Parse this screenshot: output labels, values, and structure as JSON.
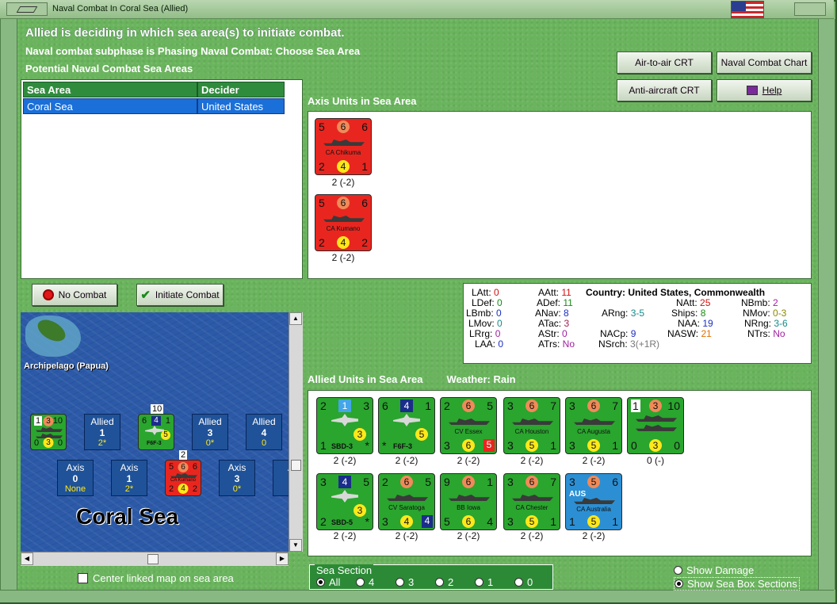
{
  "window": {
    "title": "Naval Combat In Coral Sea (Allied)"
  },
  "header": {
    "line1": "Allied is deciding in which sea area(s) to initiate combat.",
    "line2": "Naval combat subphase is Phasing Naval Combat: Choose Sea Area",
    "line3": "Potential Naval Combat Sea Areas"
  },
  "buttons": {
    "air_to_air": "Air-to-air CRT",
    "naval_chart": "Naval Combat Chart",
    "anti_aircraft": "Anti-aircraft CRT",
    "help": "Help",
    "no_combat": "No Combat",
    "initiate_combat": "Initiate Combat"
  },
  "sea_table": {
    "columns": [
      "Sea Area",
      "Decider"
    ],
    "rows": [
      [
        "Coral Sea",
        "United States"
      ]
    ]
  },
  "axis_units": {
    "label": "Axis Units in Sea Area",
    "units": [
      {
        "name": "CA Chikuma",
        "tl": "5",
        "tc": "6",
        "tr": "6",
        "bl": "2",
        "bc": "4",
        "br": "1",
        "strength": "2 (-2)"
      },
      {
        "name": "CA Kumano",
        "tl": "5",
        "tc": "6",
        "tr": "6",
        "bl": "2",
        "bc": "4",
        "br": "2",
        "strength": "2 (-2)"
      }
    ]
  },
  "stats": {
    "country_label": "Country:",
    "country": "United States, Commonwealth",
    "col1": [
      [
        "LAtt:",
        "0"
      ],
      [
        "LDef:",
        "0"
      ],
      [
        "LBmb:",
        "0"
      ],
      [
        "LMov:",
        "0"
      ],
      [
        "LRrg:",
        "0"
      ],
      [
        "LAA:",
        "0"
      ]
    ],
    "col2": [
      [
        "AAtt:",
        "11"
      ],
      [
        "ADef:",
        "11"
      ],
      [
        "ANav:",
        "8"
      ],
      [
        "ATac:",
        "3"
      ],
      [
        "AStr:",
        "0"
      ],
      [
        "ATrs:",
        "No"
      ]
    ],
    "col3": [
      [
        "ARng:",
        "3-5"
      ],
      [
        "NACp:",
        "9"
      ],
      [
        "NSrch:",
        "3(+1R)"
      ]
    ],
    "col4": [
      [
        "NAtt:",
        "25"
      ],
      [
        "Ships:",
        "8"
      ],
      [
        "NAA:",
        "19"
      ],
      [
        "NASW:",
        "21"
      ]
    ],
    "col5": [
      [
        "NBmb:",
        "2"
      ],
      [
        "NMov:",
        "0-3"
      ],
      [
        "NRng:",
        "3-6"
      ],
      [
        "NTrs:",
        "No"
      ]
    ],
    "colors": {
      "red": "#d01010",
      "green": "#1a8a1a",
      "blue": "#1b2fc0",
      "teal": "#168a8a",
      "purple": "#a020a0",
      "orange": "#e07000",
      "gray": "#777777"
    }
  },
  "allied_units": {
    "label": "Allied Units in Sea Area",
    "weather": "Weather:  Rain",
    "units": [
      {
        "name": "SBD-3",
        "kind": "plane",
        "tl": "2",
        "tc": "1",
        "tr": "3",
        "bl": "1",
        "bc": "3",
        "br": "*",
        "strength": "2 (-2)"
      },
      {
        "name": "F6F-3",
        "kind": "plane",
        "tl": "6",
        "tc": "4",
        "tr": "1",
        "bl": "*",
        "bc": "5",
        "br": "",
        "strength": "2 (-2)"
      },
      {
        "name": "CV Essex",
        "kind": "ship",
        "tl": "2",
        "tc": "6",
        "tr": "5",
        "bl": "3",
        "bc": "6",
        "br": "5",
        "strength": "2 (-2)"
      },
      {
        "name": "CA Houston",
        "kind": "ship",
        "tl": "3",
        "tc": "6",
        "tr": "7",
        "bl": "3",
        "bc": "5",
        "br": "1",
        "strength": "2 (-2)"
      },
      {
        "name": "CA Augusta",
        "kind": "ship",
        "tl": "3",
        "tc": "6",
        "tr": "7",
        "bl": "3",
        "bc": "5",
        "br": "1",
        "strength": "2 (-2)"
      },
      {
        "name": "",
        "kind": "stack",
        "tl": "1",
        "tc": "3",
        "tr": "10",
        "bl": "0",
        "bc": "3",
        "br": "0",
        "strength": "0 (-)"
      },
      {
        "name": "SBD-5",
        "kind": "plane",
        "tl": "3",
        "tc": "4",
        "tr": "5",
        "bl": "2",
        "bc": "3",
        "br": "*",
        "strength": "2 (-2)"
      },
      {
        "name": "CV Saratoga",
        "kind": "ship",
        "tl": "2",
        "tc": "6",
        "tr": "5",
        "bl": "3",
        "bc": "4",
        "br": "4",
        "strength": "2 (-2)"
      },
      {
        "name": "BB Iowa",
        "kind": "ship",
        "tl": "9",
        "tc": "6",
        "tr": "1",
        "bl": "5",
        "bc": "6",
        "br": "4",
        "strength": "2 (-2)"
      },
      {
        "name": "CA Chester",
        "kind": "ship",
        "tl": "3",
        "tc": "6",
        "tr": "7",
        "bl": "3",
        "bc": "5",
        "br": "1",
        "strength": "2 (-2)"
      },
      {
        "name": "CA Australia",
        "kind": "ship",
        "tl": "3",
        "tc": "5",
        "tr": "6",
        "bl": "1",
        "bc": "5",
        "br": "1",
        "strength": "2 (-2)",
        "tag": "AUS"
      }
    ]
  },
  "map": {
    "area_name": "Archipelago (Papua)",
    "sea_name": "Coral Sea",
    "boxes": [
      {
        "side": "Allied",
        "num": "1",
        "sub": "2*"
      },
      {
        "side": "Allied",
        "num": "3",
        "sub": "0*"
      },
      {
        "side": "Allied",
        "num": "4",
        "sub": "0"
      },
      {
        "side": "Axis",
        "num": "0",
        "sub": "None"
      },
      {
        "side": "Axis",
        "num": "1",
        "sub": "2*"
      },
      {
        "side": "Axis",
        "num": "3",
        "sub": "0*"
      },
      {
        "side": "A",
        "num": "",
        "sub": ""
      }
    ],
    "stack_count_allied": "10",
    "stack_count_axis": "2",
    "map_counter_allied_stack": {
      "tl": "1",
      "tc": "3",
      "tr": "10",
      "bl": "0",
      "bc": "3",
      "br": "0"
    },
    "map_counter_plane": {
      "tl": "6",
      "tc": "4",
      "tr": "1",
      "bc": "5",
      "name": "F6F-3"
    },
    "map_counter_axis": {
      "tl": "5",
      "tc": "6",
      "tr": "6",
      "bl": "2",
      "bc": "4",
      "br": "2",
      "name": "CA Kumano"
    }
  },
  "footer": {
    "center_map": "Center linked map on sea area",
    "sea_section_label": "Sea Section",
    "sea_section_options": [
      "All",
      "4",
      "3",
      "2",
      "1",
      "0"
    ],
    "show_damage": "Show Damage",
    "show_boxes": "Show Sea Box Sections"
  }
}
